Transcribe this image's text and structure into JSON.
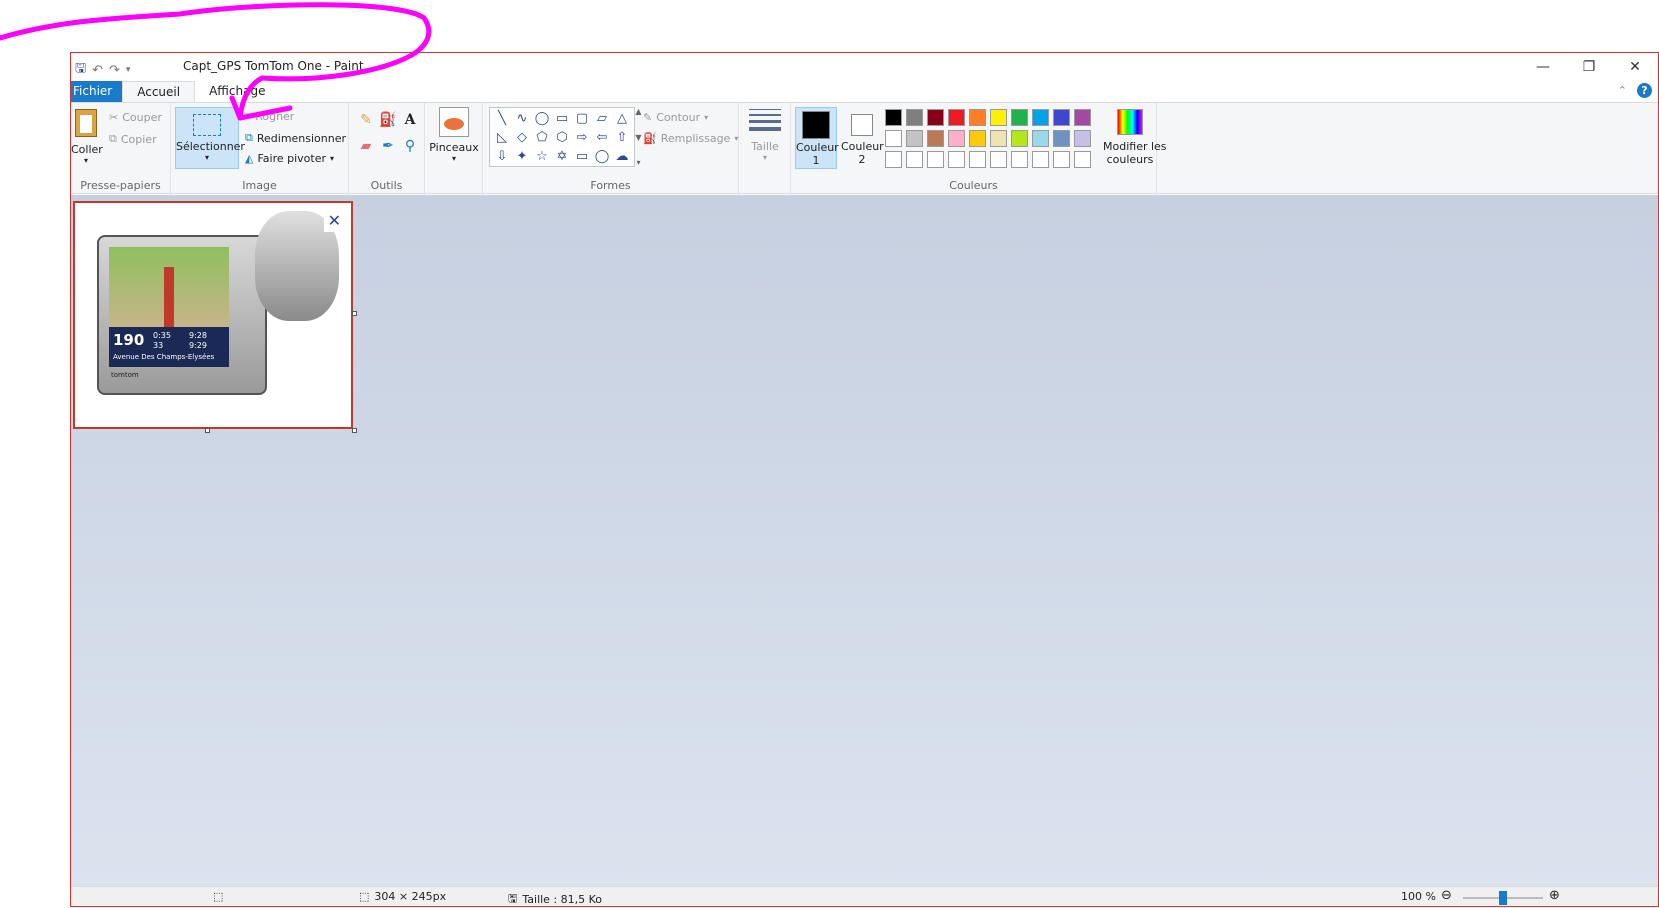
{
  "window": {
    "title": "Capt_GPS TomTom One - Paint",
    "controls": {
      "minimize": "—",
      "restore": "❐",
      "close": "✕"
    }
  },
  "tabs": {
    "file": "Fichier",
    "home": "Accueil",
    "view": "Affichage"
  },
  "clipboard": {
    "paste": "Coller",
    "cut": "Couper",
    "copy": "Copier",
    "group": "Presse-papiers"
  },
  "image": {
    "select": "Sélectionner",
    "crop": "Rogner",
    "resize": "Redimensionner",
    "rotate": "Faire pivoter",
    "group": "Image"
  },
  "tools": {
    "group": "Outils"
  },
  "brushes": {
    "label": "Pinceaux"
  },
  "shapes": {
    "group": "Formes",
    "outline": "Contour",
    "fill": "Remplissage",
    "glyphs": [
      "╲",
      "∿",
      "◯",
      "▭",
      "▢",
      "▱",
      "△",
      "◺",
      "◇",
      "⬠",
      "⬡",
      "⇨",
      "⇦",
      "⇧",
      "⇩",
      "✦",
      "☆",
      "✡",
      "▭",
      "◯",
      "☁"
    ]
  },
  "size": {
    "label": "Taille"
  },
  "colors": {
    "color1": "Couleur",
    "color1_num": "1",
    "color2": "Couleur",
    "color2_num": "2",
    "edit": "Modifier les",
    "edit2": "couleurs",
    "group": "Couleurs",
    "palette": [
      "#000000",
      "#7f7f7f",
      "#880015",
      "#ed1c24",
      "#ff7f27",
      "#fff200",
      "#22b14c",
      "#00a2e8",
      "#3f48cc",
      "#a349a4",
      "#ffffff",
      "#c3c3c3",
      "#b97a57",
      "#ffaec9",
      "#ffc90e",
      "#efe4b0",
      "#b5e61d",
      "#99d9ea",
      "#7092be",
      "#c8bfe7",
      "#ffffff",
      "#ffffff",
      "#ffffff",
      "#ffffff",
      "#ffffff",
      "#ffffff",
      "#ffffff",
      "#ffffff",
      "#ffffff",
      "#ffffff"
    ]
  },
  "canvas": {
    "gps_distance": "190",
    "gps_street": "Avenue Des Champs-Elysées",
    "gps_brand": "tomtom",
    "gps_time1": "9:28",
    "gps_time2": "9:29",
    "gps_speed1": "0:35",
    "gps_speed2": "33",
    "close_glyph": "✕"
  },
  "status": {
    "dimensions": "304 × 245px",
    "filesize": "Taille : 81,5 Ko",
    "zoom": "100 %",
    "zoom_out": "⊖",
    "zoom_in": "⊕"
  }
}
